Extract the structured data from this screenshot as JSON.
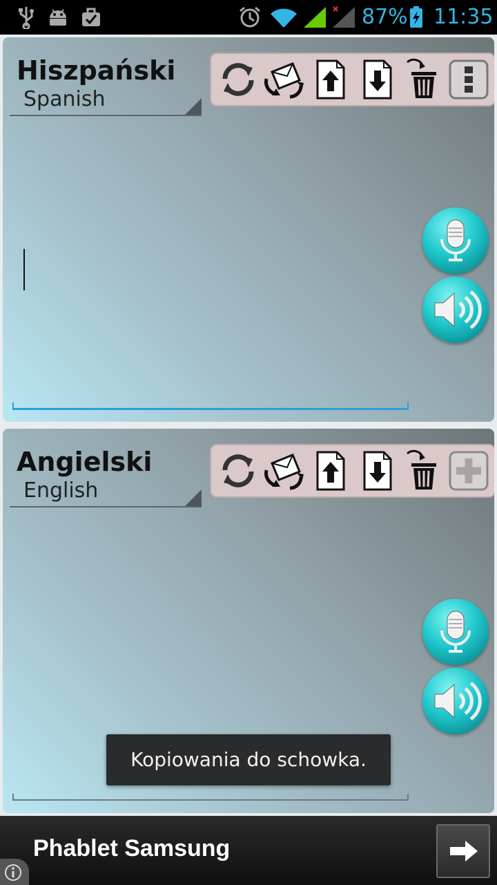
{
  "status_bar": {
    "battery_percent": "87%",
    "time": "11:35",
    "icons": [
      "usb-icon",
      "android-icon",
      "briefcase-icon",
      "alarm-icon",
      "wifi-icon",
      "signal-icon",
      "signal-no-data-icon",
      "battery-charging-icon"
    ]
  },
  "source_panel": {
    "language_name": "Hiszpański",
    "language_sub": "Spanish",
    "text_value": "",
    "toolbar_icons": [
      "swap-icon",
      "share-mail-icon",
      "upload-icon",
      "download-icon",
      "delete-icon",
      "menu-icon"
    ],
    "mic_icon": "microphone-icon",
    "speaker_icon": "speaker-icon"
  },
  "target_panel": {
    "language_name": "Angielski",
    "language_sub": "English",
    "text_value": "",
    "toolbar_icons": [
      "swap-icon",
      "share-mail-icon",
      "upload-icon",
      "download-icon",
      "delete-icon",
      "add-icon"
    ],
    "mic_icon": "microphone-icon",
    "speaker_icon": "speaker-icon"
  },
  "toast": {
    "message": "Kopiowania do schowka."
  },
  "ad_bar": {
    "text": "Phablet Samsung",
    "arrow_icon": "arrow-right-icon",
    "info_icon": "info-icon"
  },
  "colors": {
    "accent": "#33b5e5",
    "button_teal": "#1fc8cc",
    "toolbar_bg": "#dbc9ca",
    "active_underline": "#2a9fd6"
  }
}
